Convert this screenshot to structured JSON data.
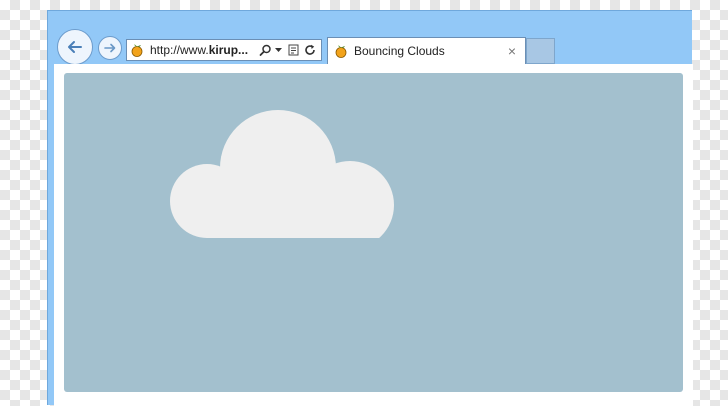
{
  "browser": {
    "address_bar": {
      "url_prefix": "http://www.",
      "url_bold": "kirup...",
      "icons": [
        "search-icon",
        "dropdown-arrow-icon",
        "compatibility-icon",
        "refresh-icon"
      ]
    },
    "nav": {
      "back": "back-arrow-icon",
      "forward": "forward-arrow-icon"
    },
    "tabs": [
      {
        "title": "Bouncing Clouds",
        "close": "×",
        "favicon": "fruit-favicon-icon"
      }
    ]
  },
  "page": {
    "background_color": "#a3c0ce",
    "cloud_color": "#efefef",
    "shape": "cloud-icon"
  }
}
